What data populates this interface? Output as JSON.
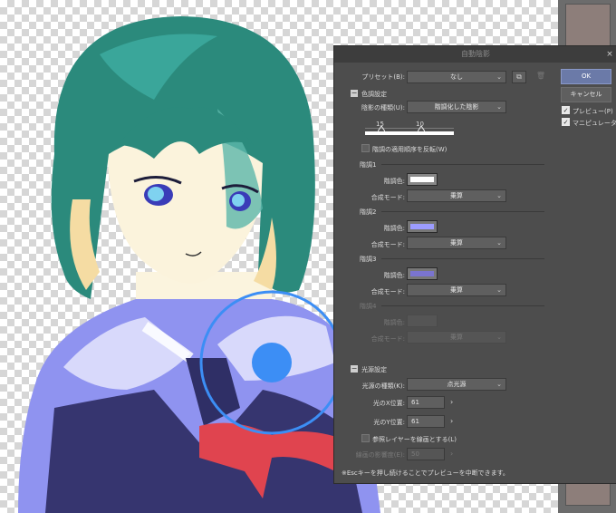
{
  "dialog": {
    "title": "自動陰影",
    "close": "×",
    "preset_label": "プリセット(B):",
    "preset_value": "なし",
    "ok": "OK",
    "cancel": "キャンセル",
    "preview_label": "プレビュー(P)",
    "manipulator_label": "マニピュレータ(M",
    "tone_section": "色調設定",
    "shadow_type_label": "陰影の種類(U):",
    "shadow_type_value": "階調化した陰影",
    "slider_values": [
      "15",
      "10"
    ],
    "reverse_label": "階調の適用順序を反転(W)",
    "tones": [
      {
        "header": "階調1",
        "color_label": "階調色:",
        "color": "#ffffff",
        "blend_label": "合成モード:",
        "blend_value": "乗算"
      },
      {
        "header": "階調2",
        "color_label": "階調色:",
        "color": "#9c9cff",
        "blend_label": "合成モード:",
        "blend_value": "乗算"
      },
      {
        "header": "階調3",
        "color_label": "階調色:",
        "color": "#7a74cf",
        "blend_label": "合成モード:",
        "blend_value": "乗算"
      },
      {
        "header": "階調4",
        "color_label": "階調色:",
        "color": "",
        "blend_label": "合成モード:",
        "blend_value": "乗算"
      }
    ],
    "light_section": "光源設定",
    "light_type_label": "光源の種類(K):",
    "light_type_value": "点光源",
    "light_x_label": "光のX位置:",
    "light_x_value": "61",
    "light_y_label": "光のY位置:",
    "light_y_value": "61",
    "ref_layer_label": "参照レイヤーを線画とする(L)",
    "line_strength_label": "線画の影響度(E):",
    "line_strength_value": "50",
    "footer_note": "※Escキーを押し続けることでプレビューを中断できます。"
  },
  "colors": {
    "dialog_bg": "#4d4d4d",
    "ok_button": "#6b7aa8",
    "light_marker": "#3c8ef5"
  }
}
